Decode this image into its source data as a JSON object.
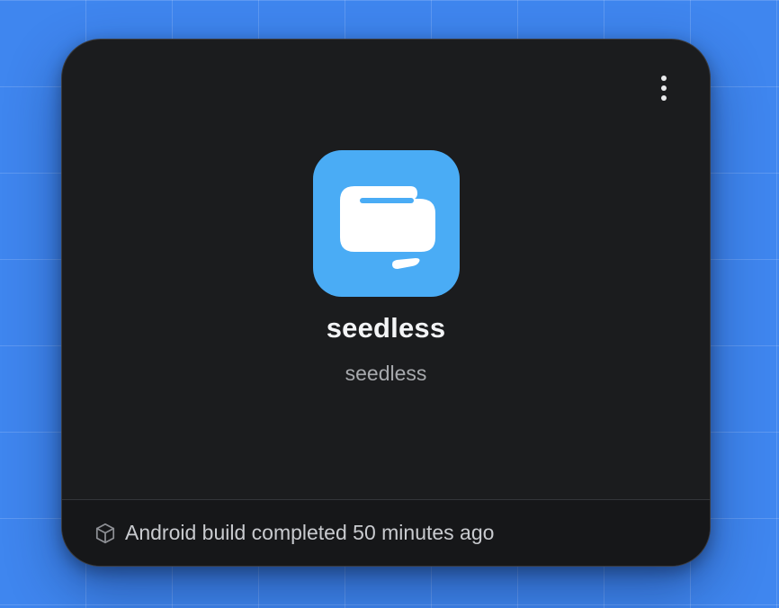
{
  "project_card": {
    "app_name": "seedless",
    "app_slug": "seedless",
    "icon_name": "chat-bubble-app-icon",
    "menu_icon": "more-vertical-icon",
    "status_icon": "cube-icon",
    "status_text": "Android build completed 50 minutes ago",
    "colors": {
      "page_background": "#3f86ef",
      "card_background": "#1b1c1e",
      "icon_background": "#4aacf5"
    }
  }
}
